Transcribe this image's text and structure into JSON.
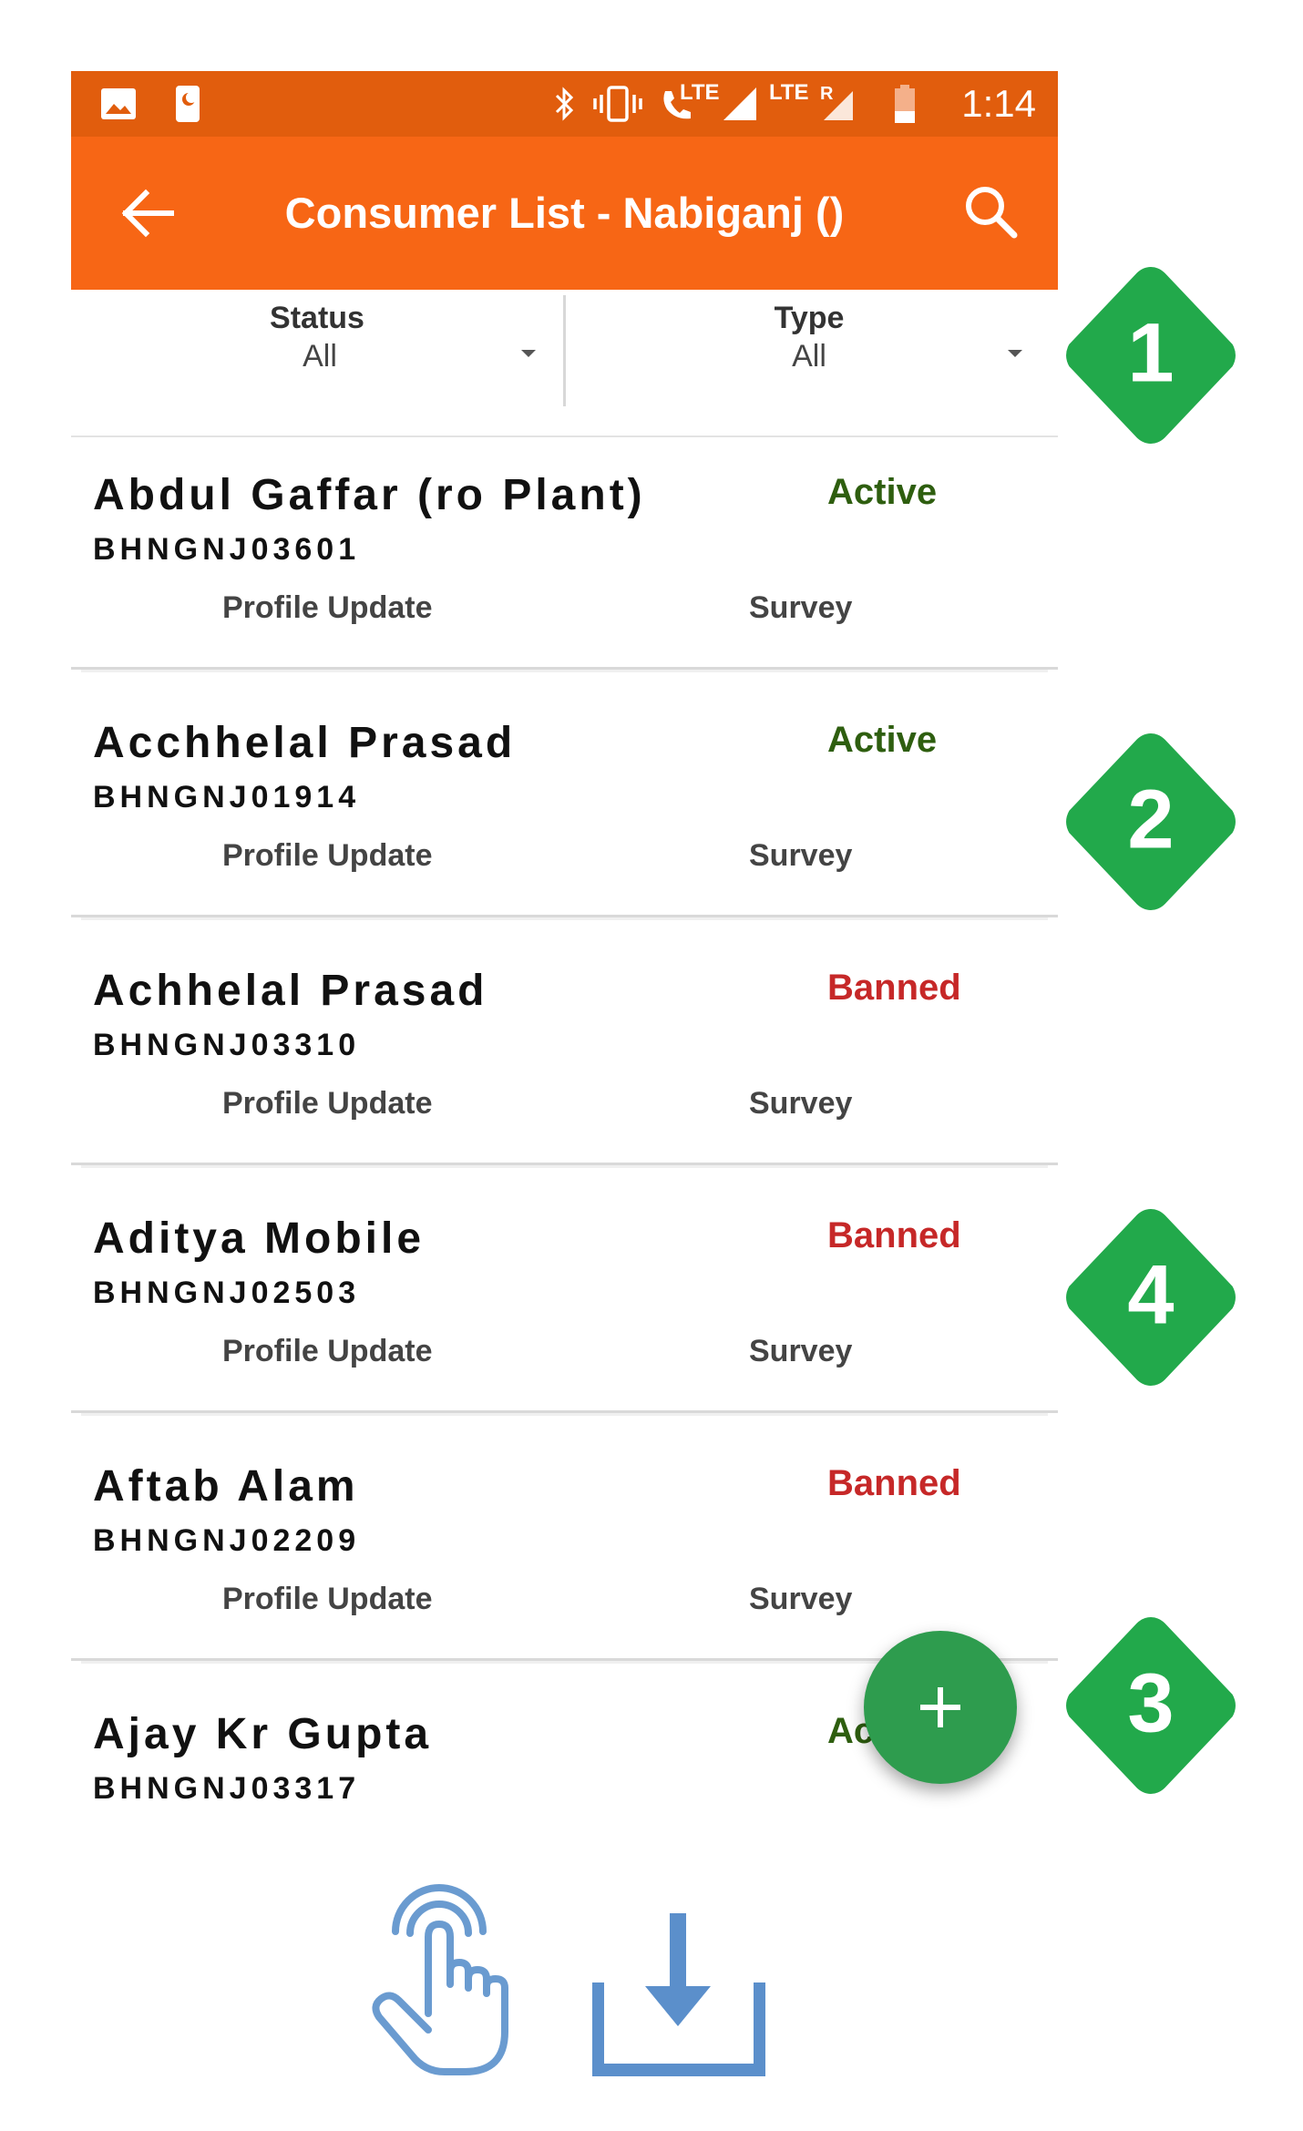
{
  "status_bar": {
    "time": "1:14",
    "lte_small": "LTE",
    "lte_main": "LTE",
    "roaming": "R",
    "icons": [
      "image-icon",
      "moon-clock-icon",
      "bluetooth-icon",
      "vibrate-icon",
      "volte-call-icon",
      "signal-icon",
      "signal-roaming-icon",
      "battery-low-icon"
    ]
  },
  "app_bar": {
    "title": "Consumer List - Nabiganj ()",
    "back_icon": "back-arrow-icon",
    "search_icon": "search-icon",
    "color": "#f76615",
    "status_color": "#e15d0d"
  },
  "filters": {
    "status": {
      "label": "Status",
      "value": "All"
    },
    "type": {
      "label": "Type",
      "value": "All"
    }
  },
  "consumers": [
    {
      "name": "Abdul Gaffar (ro Plant)",
      "code": "BHNGNJ03601",
      "status": "Active",
      "status_color": "#2e5e0f",
      "profile_label": "Profile Update",
      "survey_label": "Survey"
    },
    {
      "name": "Acchhelal Prasad",
      "code": "BHNGNJ01914",
      "status": "Active",
      "status_color": "#2e5e0f",
      "profile_label": "Profile Update",
      "survey_label": "Survey"
    },
    {
      "name": "Achhelal Prasad",
      "code": "BHNGNJ03310",
      "status": "Banned",
      "status_color": "#c62828",
      "profile_label": "Profile Update",
      "survey_label": "Survey"
    },
    {
      "name": "Aditya Mobile",
      "code": "BHNGNJ02503",
      "status": "Banned",
      "status_color": "#c62828",
      "profile_label": "Profile Update",
      "survey_label": "Survey"
    },
    {
      "name": "Aftab Alam",
      "code": "BHNGNJ02209",
      "status": "Banned",
      "status_color": "#c62828",
      "profile_label": "Profile Update",
      "survey_label": "Survey"
    },
    {
      "name": "Ajay Kr Gupta",
      "code": "BHNGNJ03317",
      "status": "Ac",
      "status_color": "#2e5e0f"
    }
  ],
  "fab": {
    "icon": "plus-icon",
    "color": "#2e9c4e"
  },
  "annotations": {
    "color": "#22a94b",
    "badges": [
      "1",
      "2",
      "3",
      "4"
    ]
  },
  "bottom_icons": [
    "tap-hand-icon",
    "download-icon"
  ]
}
